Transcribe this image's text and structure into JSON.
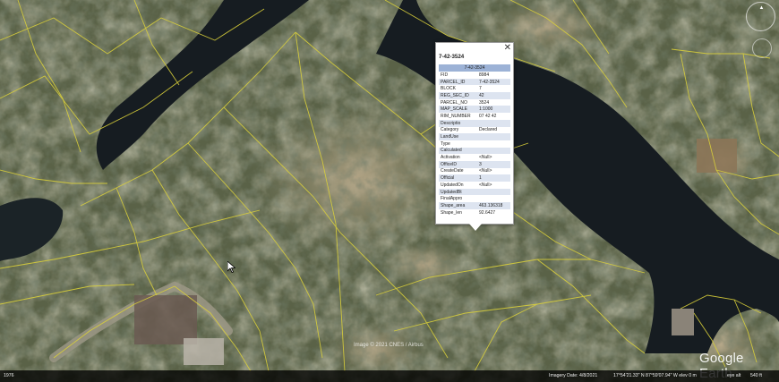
{
  "popup": {
    "title": "7-42-3524",
    "header": "7-42-3524",
    "close_icon": "close-icon",
    "rows": [
      {
        "k": "FID",
        "v": "8984"
      },
      {
        "k": "PARCEL_ID",
        "v": "7-42-3524"
      },
      {
        "k": "BLOCK",
        "v": "7"
      },
      {
        "k": "REG_SEC_ID",
        "v": "42"
      },
      {
        "k": "PARCEL_NO",
        "v": "3524"
      },
      {
        "k": "MAP_SCALE",
        "v": "1:1000"
      },
      {
        "k": "RIM_NUMBER",
        "v": "07 42 42"
      },
      {
        "k": "Descriptio",
        "v": ""
      },
      {
        "k": "Category",
        "v": "Declared"
      },
      {
        "k": "LandUse",
        "v": ""
      },
      {
        "k": "Type",
        "v": ""
      },
      {
        "k": "Calculated",
        "v": ""
      },
      {
        "k": "Activation",
        "v": "<Null>"
      },
      {
        "k": "OfficeID",
        "v": "3"
      },
      {
        "k": "CreateDate",
        "v": "<Null>"
      },
      {
        "k": "Official",
        "v": "1"
      },
      {
        "k": "UpdatedOn",
        "v": "<Null>"
      },
      {
        "k": "UpdatedBt",
        "v": ""
      },
      {
        "k": "FinalAppro",
        "v": ""
      },
      {
        "k": "Shape_area",
        "v": "463.136318"
      },
      {
        "k": "Shape_len",
        "v": "92.6427"
      }
    ]
  },
  "watermark": "Image © 2021 CNES / Airbus",
  "brand": "Google Earth",
  "status": {
    "left": "1976",
    "imagery_date": "Imagery Date: 4/8/2021",
    "coords": "17°54'21.33\" N   87°59'07.94\" W   elev  0 m",
    "eye_alt": "eye alt",
    "eye_alt_value": "540 ft"
  },
  "colors": {
    "parcel_lines": "#d9cf3a",
    "water": "#151b20",
    "popup_header": "#9cb2d6"
  },
  "icons": {
    "compass": "compass-icon",
    "zoom": "zoom-control-icon",
    "cursor": "mouse-pointer-icon"
  }
}
